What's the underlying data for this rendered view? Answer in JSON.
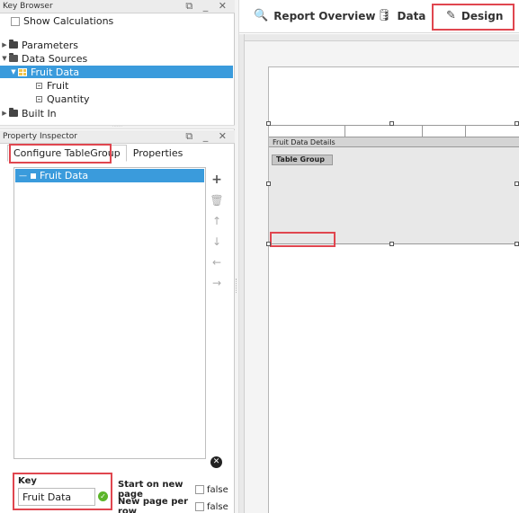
{
  "key_browser": {
    "title": "Key Browser",
    "show_calculations": "Show Calculations",
    "tree": {
      "parameters": "Parameters",
      "data_sources": "Data Sources",
      "fruit_data": "Fruit Data",
      "fruit": "Fruit",
      "quantity": "Quantity",
      "built_in": "Built In"
    }
  },
  "property_inspector": {
    "title": "Property Inspector",
    "tabs": [
      "Configure TableGroup",
      "Properties"
    ],
    "list_items": [
      "Fruit Data"
    ],
    "key_label": "Key",
    "key_value": "Fruit Data",
    "start_on_new_page": {
      "label": "Start on new page",
      "value": "false"
    },
    "new_page_per_row": {
      "label": "New page per row",
      "value": "false"
    }
  },
  "toolbar": {
    "report_overview": "Report Overview",
    "data": "Data",
    "design": "Design"
  },
  "design_canvas": {
    "detail_label": "Fruit Data Details",
    "group_label": "Table Group"
  },
  "colors": {
    "selection": "#3a9bdc",
    "highlight": "#e0464f",
    "valid": "#5cb52a"
  }
}
